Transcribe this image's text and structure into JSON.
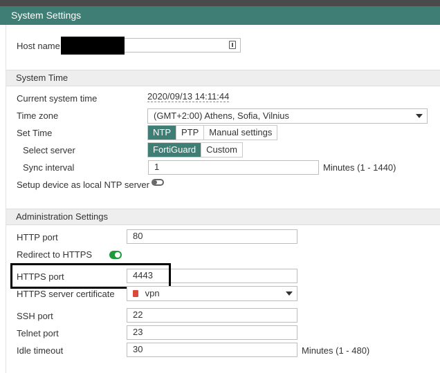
{
  "window": {
    "title": "System Settings"
  },
  "host": {
    "label": "Host name",
    "value": ""
  },
  "system_time": {
    "section_title": "System Time",
    "current_label": "Current system time",
    "current_value": "2020/09/13 14:11:44",
    "timezone_label": "Time zone",
    "timezone_value": "(GMT+2:00) Athens, Sofia, Vilnius",
    "set_time_label": "Set Time",
    "set_time_options": [
      "NTP",
      "PTP",
      "Manual settings"
    ],
    "set_time_selected": "NTP",
    "select_server_label": "Select server",
    "server_options": [
      "FortiGuard",
      "Custom"
    ],
    "server_selected": "FortiGuard",
    "sync_label": "Sync interval",
    "sync_value": "1",
    "sync_unit": "Minutes (1 - 1440)",
    "local_ntp_label": "Setup device as local NTP server",
    "local_ntp_enabled": false
  },
  "admin": {
    "section_title": "Administration Settings",
    "http_label": "HTTP port",
    "http_value": "80",
    "redirect_label": "Redirect to HTTPS",
    "redirect_enabled": true,
    "https_label": "HTTPS port",
    "https_value": "4443",
    "cert_label": "HTTPS server certificate",
    "cert_value": "vpn",
    "ssh_label": "SSH port",
    "ssh_value": "22",
    "telnet_label": "Telnet port",
    "telnet_value": "23",
    "idle_label": "Idle timeout",
    "idle_value": "30",
    "idle_unit": "Minutes (1 - 480)"
  },
  "icons": {
    "host_field": "clipboard-icon",
    "timezone": "chevron-down-icon",
    "certificate": "certificate-icon"
  },
  "colors": {
    "accent": "#3e7e74",
    "toggle_on": "#1f9a3a"
  }
}
